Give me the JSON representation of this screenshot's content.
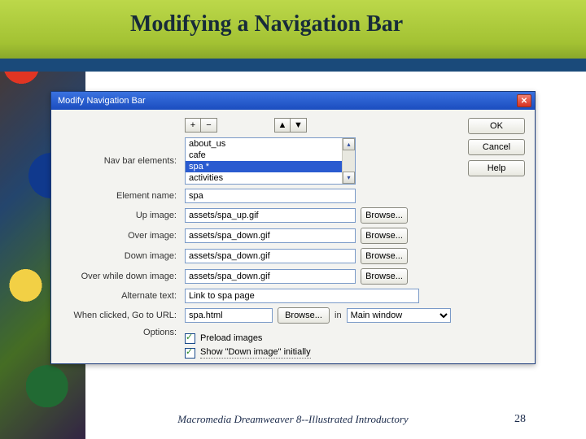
{
  "slide": {
    "title": "Modifying a Navigation Bar",
    "footer_credit": "Macromedia Dreamweaver 8--Illustrated Introductory",
    "page_number": "28"
  },
  "dialog": {
    "title": "Modify Navigation Bar",
    "buttons": {
      "ok": "OK",
      "cancel": "Cancel",
      "help": "Help"
    },
    "toolbar": {
      "plus": "+",
      "minus": "−",
      "up": "▲",
      "down": "▼"
    },
    "labels": {
      "nav_bar_elements": "Nav bar elements:",
      "element_name": "Element name:",
      "up_image": "Up image:",
      "over_image": "Over image:",
      "down_image": "Down image:",
      "over_while_down": "Over while down image:",
      "alternate_text": "Alternate text:",
      "when_clicked": "When clicked, Go to URL:",
      "options": "Options:",
      "in": "in",
      "browse": "Browse..."
    },
    "nav_elements": {
      "items": [
        "about_us",
        "cafe",
        "spa *",
        "activities"
      ],
      "selected_index": 2
    },
    "fields": {
      "element_name": "spa",
      "up_image": "assets/spa_up.gif",
      "over_image": "assets/spa_down.gif",
      "down_image": "assets/spa_down.gif",
      "over_while_down": "assets/spa_down.gif",
      "alternate_text": "Link to spa page",
      "goto_url": "spa.html",
      "target_window": "Main window"
    },
    "options_group": {
      "preload": {
        "label": "Preload images",
        "checked": true
      },
      "show_down": {
        "label": "Show \"Down image\" initially",
        "checked": true
      }
    }
  }
}
